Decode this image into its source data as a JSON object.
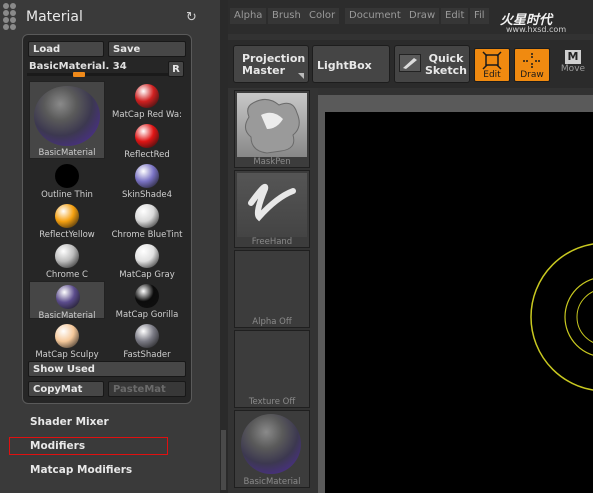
{
  "panel": {
    "title": "Material",
    "refresh_icon": "refresh-icon",
    "load_label": "Load",
    "save_label": "Save",
    "slider_label": "BasicMaterial. 34",
    "slider_value_fraction": 0.34,
    "r_label": "R",
    "current_material_label": "BasicMaterial",
    "materials": [
      {
        "label": "MatCap  Red  Wa:",
        "color": "#d02020"
      },
      {
        "label": "ReflectRed",
        "color": "#e01515"
      },
      {
        "label": "Outline  Thin",
        "color": "#000000"
      },
      {
        "label": "SkinShade4",
        "color": "#7a73c4"
      },
      {
        "label": "ReflectYellow",
        "color": "#f5a010"
      },
      {
        "label": "Chrome  BlueTint",
        "color": "#d8d8d8"
      },
      {
        "label": "Chrome  C",
        "color": "#bcbcbc"
      },
      {
        "label": "MatCap  Gray",
        "color": "#e0e0e0"
      },
      {
        "label": "BasicMaterial",
        "color": "#5b4c8c"
      },
      {
        "label": "MatCap  Gorilla",
        "color": "#0c0c0c"
      },
      {
        "label": "MatCap  Sculpy",
        "color": "#f5c89a"
      },
      {
        "label": "FastShader",
        "color": "#7a7a84"
      }
    ],
    "show_used_label": "Show Used",
    "copymat_label": "CopyMat",
    "pastemat_label": "PasteMat",
    "items": [
      "Shader Mixer",
      "Modifiers",
      "Matcap Modifiers"
    ],
    "highlight_color": "#e01010"
  },
  "menubar": {
    "items": [
      "Alpha",
      "Brush",
      "Color",
      "Document",
      "Draw",
      "Edit",
      "Fil"
    ],
    "watermark": "火星时代",
    "watermark_url": "www.hxsd.com"
  },
  "toolbar": {
    "projection_master_label": "Projection Master",
    "lightbox_label": "LightBox",
    "quick_sketch_label": "Quick Sketch",
    "edit_label": "Edit",
    "draw_label": "Draw",
    "move_label": "Move",
    "accent_color": "#f08a10"
  },
  "shelf": {
    "items": [
      {
        "label": "MaskPen",
        "icon": "maskpen-brush-icon"
      },
      {
        "label": "FreeHand",
        "icon": "freehand-stroke-icon"
      },
      {
        "label": "Alpha  Off",
        "icon": ""
      },
      {
        "label": "Texture  Off",
        "icon": ""
      },
      {
        "label": "BasicMaterial",
        "icon": "material-sphere-icon"
      }
    ]
  }
}
